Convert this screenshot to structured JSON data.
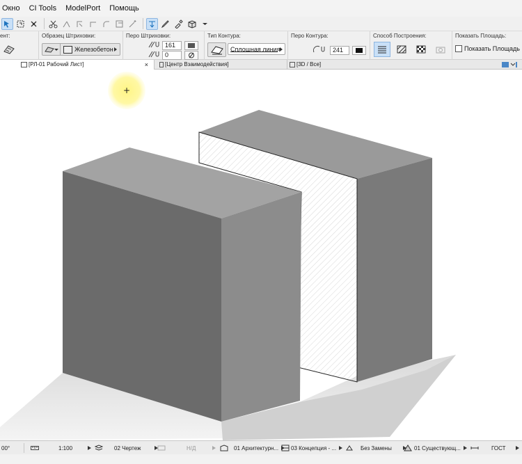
{
  "menu": {
    "items": [
      "Окно",
      "CI Tools",
      "ModelPort",
      "Помощь"
    ]
  },
  "infobox": {
    "sec0_label": "ент:",
    "hatch_label": "Образец Штриховки:",
    "hatch_value": "Железобетон",
    "hatch_pen_label": "Перо Штриховки:",
    "hatch_pen_fg": "161",
    "hatch_pen_bg": "0",
    "contour_label": "Тип Контура:",
    "contour_value": "Сплошная линия",
    "contour_pen_label": "Перо Контура:",
    "contour_pen_value": "241",
    "method_label": "Способ Построения:",
    "area_label": "Показать Площадь:",
    "area_checkbox": "Показать Площадь"
  },
  "tabs": {
    "sheet": "[РЛ-01 Рабочий Лист]",
    "sheet_close": "×",
    "center": "[Центр Взаимодействия]",
    "view3d": "[3D / Все]"
  },
  "canvas": {
    "crosshair": "+"
  },
  "statusbar": {
    "angle": "00°",
    "scale": "1:100",
    "layer": "02 Чертеж",
    "nd": "Н/Д",
    "model": "01 Архитектурн...",
    "concept": "03 Концепция - ...",
    "override": "Без Замены",
    "reno": "01 Существующ...",
    "standard": "ГОСТ"
  },
  "colors": {
    "accent": "#1e73be",
    "active_bg": "#c9e0f7",
    "cursor_highlight": "#fff79a"
  }
}
